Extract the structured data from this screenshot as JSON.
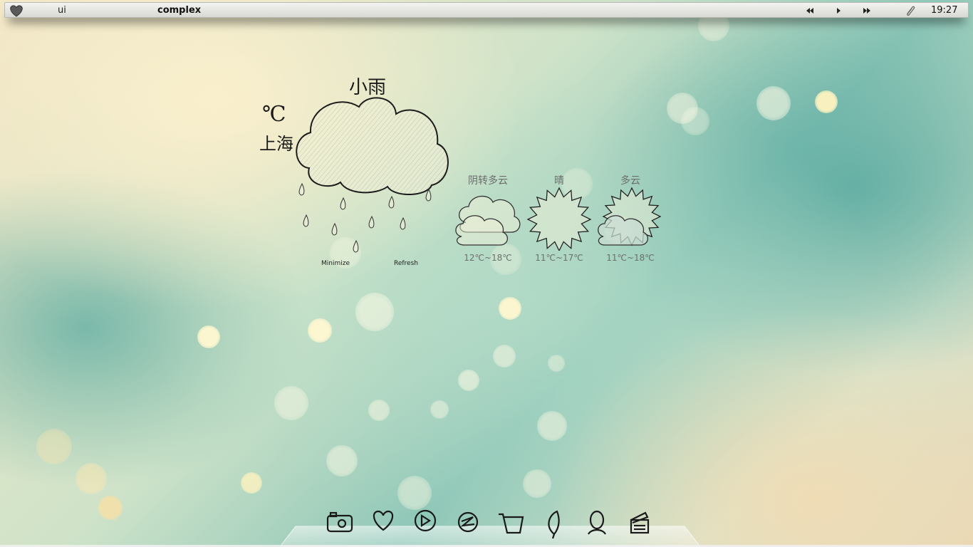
{
  "top_bar": {
    "menu_label": "ui",
    "app_title": "complex",
    "clock": "19:27",
    "icons": [
      "heart-icon",
      "rewind-icon",
      "play-icon",
      "fast-forward-icon",
      "paperclip-icon"
    ]
  },
  "weather": {
    "current_condition": "小雨",
    "unit": "℃",
    "city": "上海",
    "current_icon": "rain-cloud-icon",
    "buttons": {
      "minimize": "Minimize",
      "refresh": "Refresh"
    },
    "forecast": [
      {
        "condition": "阴转多云",
        "temp": "12℃~18℃",
        "icon": "cloud-icon"
      },
      {
        "condition": "晴",
        "temp": "11℃~17℃",
        "icon": "sun-icon"
      },
      {
        "condition": "多云",
        "temp": "11℃~18℃",
        "icon": "sun-cloud-icon"
      }
    ]
  },
  "dock": {
    "items": [
      "camera-icon",
      "heart-icon",
      "play-icon",
      "swirl-icon",
      "cart-icon",
      "leaf-icon",
      "person-icon",
      "clapperboard-icon"
    ]
  },
  "colors": {
    "text_dark": "#1a1a1a",
    "text_muted": "#6d6d6d",
    "bar": "#e4e4e0"
  }
}
